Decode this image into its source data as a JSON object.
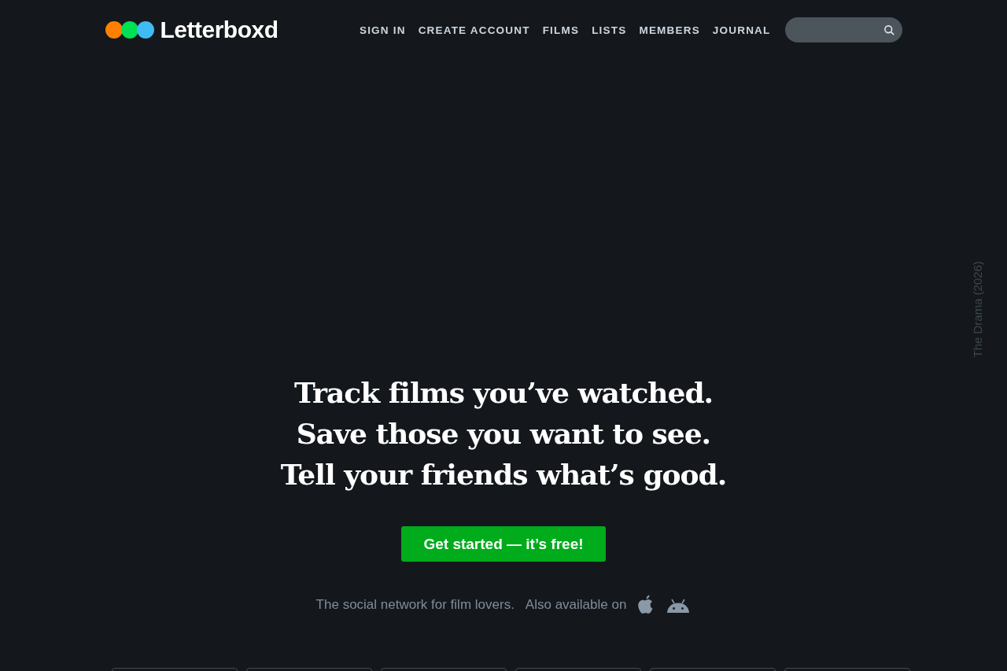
{
  "logo": {
    "text": "Letterboxd"
  },
  "nav": [
    {
      "label": "SIGN IN"
    },
    {
      "label": "CREATE ACCOUNT"
    },
    {
      "label": "FILMS"
    },
    {
      "label": "LISTS"
    },
    {
      "label": "MEMBERS"
    },
    {
      "label": "JOURNAL"
    }
  ],
  "backdrop_credit": "The Drama (2026)",
  "hero": {
    "lines": [
      "Track films you’ve watched.",
      "Save those you want to see.",
      "Tell your friends what’s good."
    ],
    "button": "Get started — it’s free!",
    "tagline": "The social network for film lovers.",
    "apps_label": "Also available on"
  },
  "poster_row": [
    {
      "kind": "poster"
    },
    {
      "kind": "poster"
    },
    {
      "kind": "poster"
    },
    {
      "kind": "poster"
    },
    {
      "kind": "poster"
    },
    {
      "kind": "poster"
    }
  ]
}
